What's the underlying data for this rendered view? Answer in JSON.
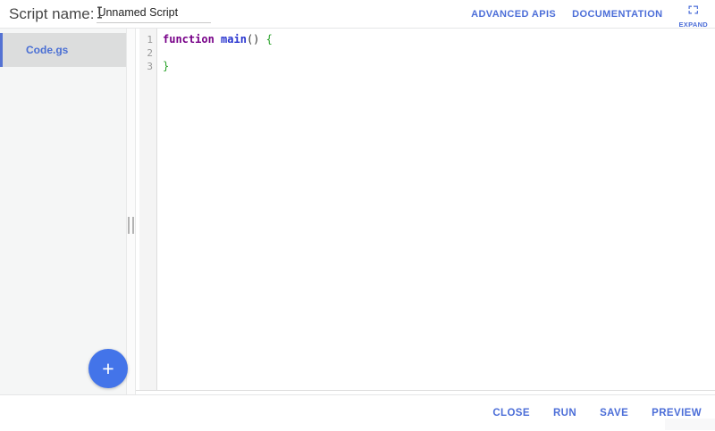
{
  "header": {
    "script_name_label": "Script name:",
    "script_name_value": "Unnamed Script",
    "links": [
      {
        "label": "ADVANCED APIS"
      },
      {
        "label": "DOCUMENTATION"
      }
    ],
    "expand_label": "EXPAND"
  },
  "sidebar": {
    "files": [
      {
        "name": "Code.gs",
        "selected": true
      }
    ]
  },
  "editor": {
    "lines": [
      {
        "number": "1",
        "tokens": [
          {
            "text": "function",
            "type": "keyword"
          },
          {
            "text": " ",
            "type": "plain"
          },
          {
            "text": "main",
            "type": "def"
          },
          {
            "text": "()",
            "type": "plain"
          },
          {
            "text": " ",
            "type": "plain"
          },
          {
            "text": "{",
            "type": "bracket"
          }
        ]
      },
      {
        "number": "2",
        "tokens": []
      },
      {
        "number": "3",
        "tokens": [
          {
            "text": "}",
            "type": "bracket"
          }
        ]
      }
    ]
  },
  "fab": {
    "label": "+"
  },
  "footer": {
    "buttons": [
      {
        "label": "CLOSE"
      },
      {
        "label": "RUN"
      },
      {
        "label": "SAVE"
      },
      {
        "label": "PREVIEW"
      }
    ]
  },
  "icons": {
    "expand_icon": "fullscreen-corner-brackets",
    "plus_icon": "plus",
    "resize_grip_icon": "vertical-grip-bars",
    "text_cursor_icon": "i-beam-text-cursor"
  },
  "colors": {
    "accent": "#4c6ed8",
    "fab": "#4374e9",
    "kw": "#770088",
    "def": "#2733cf",
    "bracket": "#2ba32b",
    "linenum": "#999999",
    "file_selected_text": "#4a6fd4",
    "file_selected_bg": "#dcdddd",
    "file_selected_border": "#5472d3",
    "sidebar_bg": "#f5f6f6",
    "border": "#e5e6e7",
    "gutter_bg": "#f4f4f4",
    "gutter_border": "#dddddd"
  }
}
